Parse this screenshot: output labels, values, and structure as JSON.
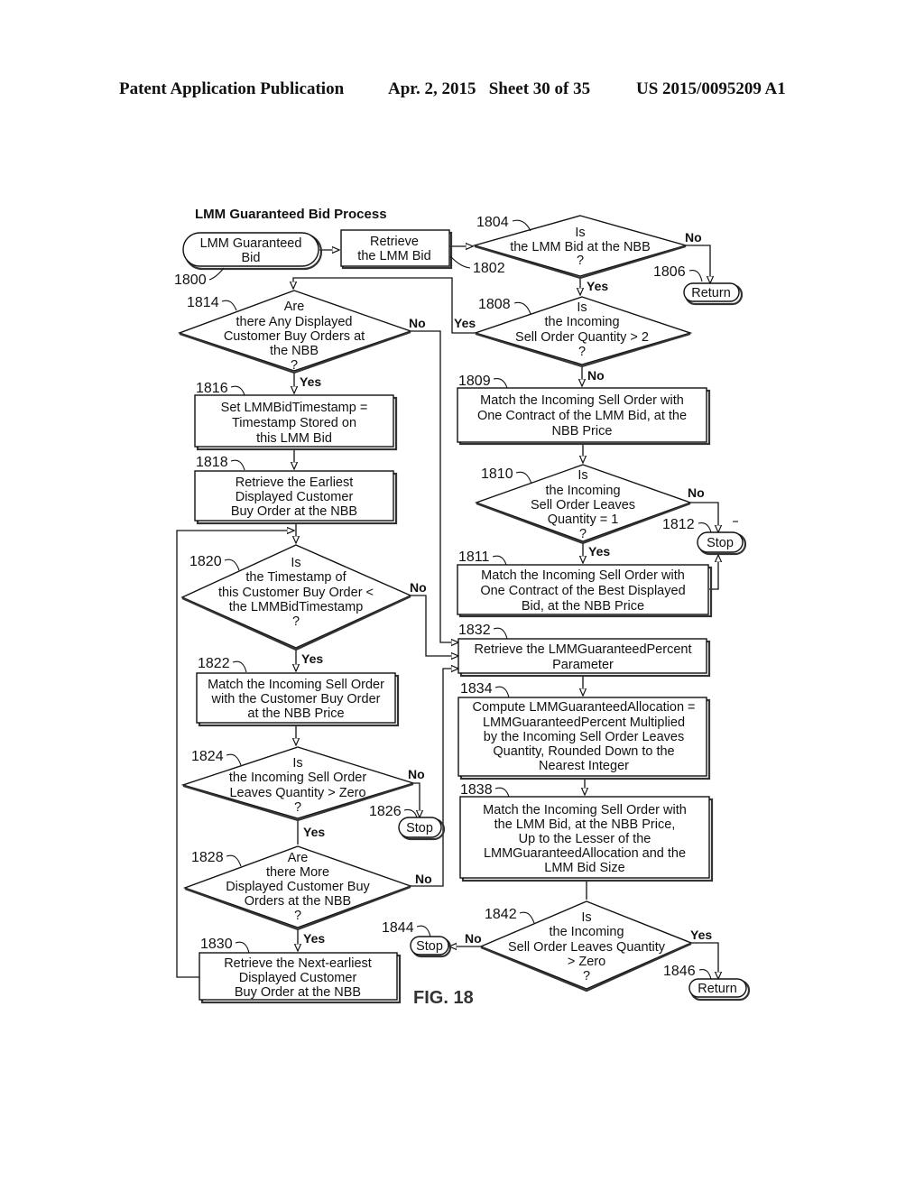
{
  "header": {
    "left": "Patent Application Publication",
    "middle": "Apr. 2, 2015   Sheet 30 of 35",
    "right": "US 2015/0095209 A1"
  },
  "diagram": {
    "title": "LMM Guaranteed Bid Process",
    "figure_label": "FIG. 18",
    "nodes": {
      "n1800": {
        "ref": "1800",
        "type": "terminal",
        "lines": [
          "LMM Guaranteed",
          "Bid"
        ]
      },
      "n1802": {
        "ref": "1802",
        "type": "process",
        "lines": [
          "Retrieve",
          "the LMM Bid"
        ]
      },
      "n1804": {
        "ref": "1804",
        "type": "decision",
        "lines": [
          "Is",
          "the LMM Bid at the NBB",
          "?"
        ]
      },
      "n1806": {
        "ref": "1806",
        "type": "terminal",
        "lines": [
          "Return"
        ]
      },
      "n1808": {
        "ref": "1808",
        "type": "decision",
        "lines": [
          "Is",
          "the Incoming",
          "Sell Order Quantity > 2",
          "?"
        ]
      },
      "n1809": {
        "ref": "1809",
        "type": "process",
        "lines": [
          "Match the Incoming Sell Order with",
          "One Contract of the LMM Bid, at the",
          "NBB Price"
        ]
      },
      "n1810": {
        "ref": "1810",
        "type": "decision",
        "lines": [
          "Is",
          "the Incoming",
          "Sell Order Leaves",
          "Quantity = 1",
          "?"
        ]
      },
      "n1811": {
        "ref": "1811",
        "type": "process",
        "lines": [
          "Match the Incoming Sell Order with",
          "One Contract of the Best Displayed",
          "Bid, at the NBB Price"
        ]
      },
      "n1812": {
        "ref": "1812",
        "type": "terminal",
        "lines": [
          "Stop"
        ]
      },
      "n1814": {
        "ref": "1814",
        "type": "decision",
        "lines": [
          "Are",
          "there Any Displayed",
          "Customer Buy Orders at",
          "the NBB",
          "?"
        ]
      },
      "n1816": {
        "ref": "1816",
        "type": "process",
        "lines": [
          "Set LMMBidTimestamp =",
          "Timestamp Stored on",
          "this LMM Bid"
        ]
      },
      "n1818": {
        "ref": "1818",
        "type": "process",
        "lines": [
          "Retrieve the Earliest",
          "Displayed Customer",
          "Buy Order at the NBB"
        ]
      },
      "n1820": {
        "ref": "1820",
        "type": "decision",
        "lines": [
          "Is",
          "the Timestamp of",
          "this Customer Buy Order <",
          "the LMMBidTimestamp",
          "?"
        ]
      },
      "n1822": {
        "ref": "1822",
        "type": "process",
        "lines": [
          "Match the Incoming Sell Order",
          "with the Customer Buy Order",
          "at the NBB Price"
        ]
      },
      "n1824": {
        "ref": "1824",
        "type": "decision",
        "lines": [
          "Is",
          "the Incoming Sell Order",
          "Leaves Quantity > Zero",
          "?"
        ]
      },
      "n1826": {
        "ref": "1826",
        "type": "terminal",
        "lines": [
          "Stop"
        ]
      },
      "n1828": {
        "ref": "1828",
        "type": "decision",
        "lines": [
          "Are",
          "there More",
          "Displayed Customer Buy",
          "Orders at the NBB",
          "?"
        ]
      },
      "n1830": {
        "ref": "1830",
        "type": "process",
        "lines": [
          "Retrieve the Next-earliest",
          "Displayed Customer",
          "Buy Order at the NBB"
        ]
      },
      "n1832": {
        "ref": "1832",
        "type": "process",
        "lines": [
          "Retrieve the LMMGuaranteedPercent",
          "Parameter"
        ]
      },
      "n1834": {
        "ref": "1834",
        "type": "process",
        "lines": [
          "Compute LMMGuaranteedAllocation =",
          "LMMGuaranteedPercent Multiplied",
          "by the Incoming Sell Order Leaves",
          "Quantity, Rounded Down to the",
          "Nearest Integer"
        ]
      },
      "n1838": {
        "ref": "1838",
        "type": "process",
        "lines": [
          "Match the Incoming Sell Order with",
          "the LMM Bid, at the NBB Price,",
          "Up to the Lesser of the",
          "LMMGuaranteedAllocation and the",
          "LMM Bid Size"
        ]
      },
      "n1842": {
        "ref": "1842",
        "type": "decision",
        "lines": [
          "Is",
          "the Incoming",
          "Sell Order Leaves Quantity",
          "> Zero",
          "?"
        ]
      },
      "n1844": {
        "ref": "1844",
        "type": "terminal",
        "lines": [
          "Stop"
        ]
      },
      "n1846": {
        "ref": "1846",
        "type": "terminal",
        "lines": [
          "Return"
        ]
      }
    },
    "edges": [
      {
        "from": "1800",
        "to": "1802",
        "label": ""
      },
      {
        "from": "1802",
        "to": "1804",
        "label": ""
      },
      {
        "from": "1804",
        "to": "1806",
        "label": "No"
      },
      {
        "from": "1804",
        "to": "1808",
        "label": "Yes"
      },
      {
        "from": "1808",
        "to": "1814",
        "label": "Yes"
      },
      {
        "from": "1808",
        "to": "1809",
        "label": "No"
      },
      {
        "from": "1809",
        "to": "1810",
        "label": ""
      },
      {
        "from": "1810",
        "to": "1812",
        "label": "No"
      },
      {
        "from": "1810",
        "to": "1811",
        "label": "Yes"
      },
      {
        "from": "1811",
        "to": "1812",
        "label": ""
      },
      {
        "from": "1814",
        "to": "1832",
        "label": "No"
      },
      {
        "from": "1814",
        "to": "1816",
        "label": "Yes"
      },
      {
        "from": "1816",
        "to": "1818",
        "label": ""
      },
      {
        "from": "1818",
        "to": "1820",
        "label": ""
      },
      {
        "from": "1820",
        "to": "1832",
        "label": "No"
      },
      {
        "from": "1820",
        "to": "1822",
        "label": "Yes"
      },
      {
        "from": "1822",
        "to": "1824",
        "label": ""
      },
      {
        "from": "1824",
        "to": "1826",
        "label": "No"
      },
      {
        "from": "1824",
        "to": "1828",
        "label": "Yes"
      },
      {
        "from": "1828",
        "to": "1832",
        "label": "No"
      },
      {
        "from": "1828",
        "to": "1830",
        "label": "Yes"
      },
      {
        "from": "1830",
        "to": "1820",
        "label": ""
      },
      {
        "from": "1832",
        "to": "1834",
        "label": ""
      },
      {
        "from": "1834",
        "to": "1838",
        "label": ""
      },
      {
        "from": "1838",
        "to": "1842",
        "label": ""
      },
      {
        "from": "1842",
        "to": "1844",
        "label": "No"
      },
      {
        "from": "1842",
        "to": "1846",
        "label": "Yes"
      }
    ],
    "labels": {
      "yes": "Yes",
      "no": "No"
    }
  }
}
